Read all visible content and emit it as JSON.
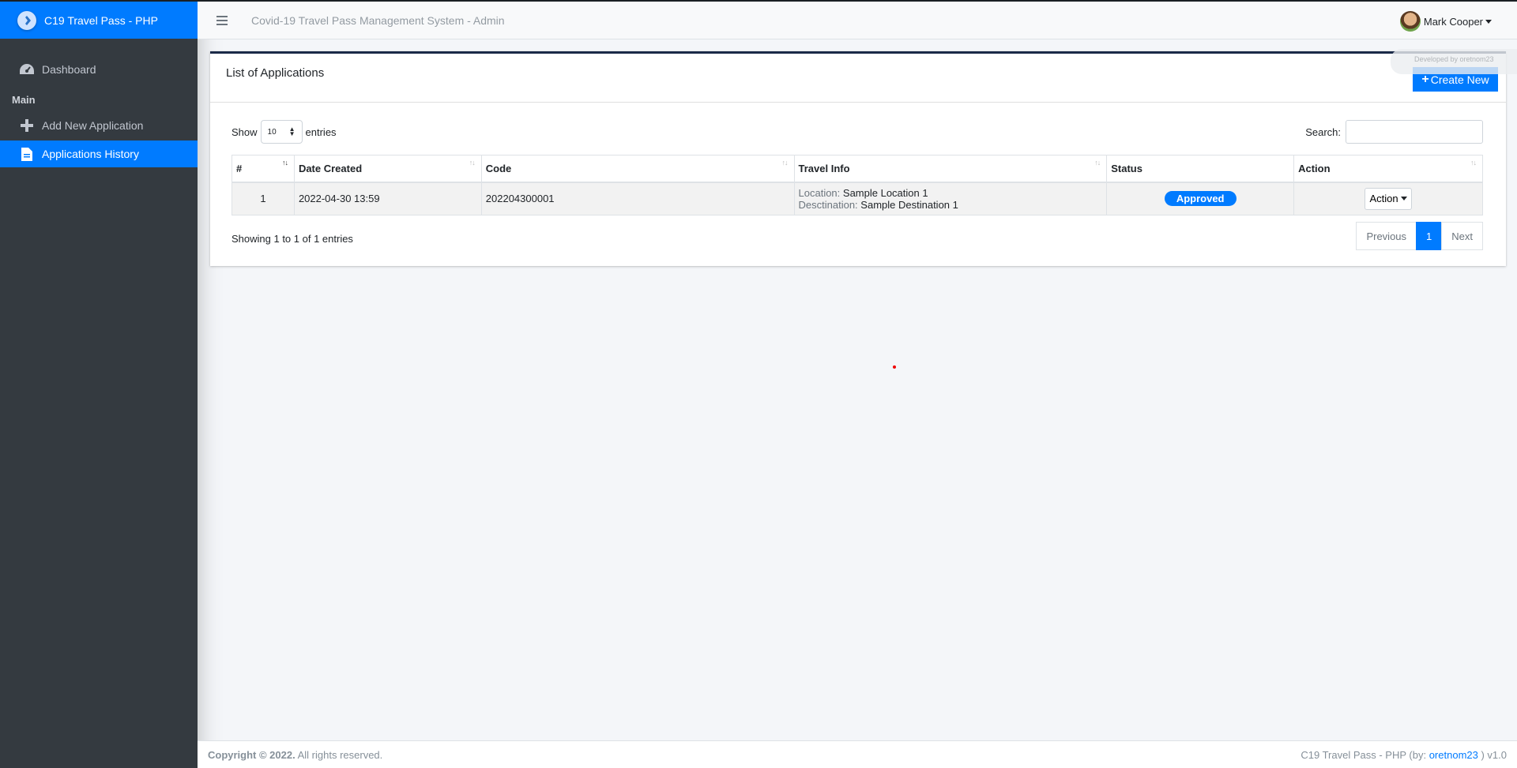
{
  "brand": {
    "name": "C19 Travel Pass - PHP"
  },
  "sidebar": {
    "items": [
      {
        "label": "Dashboard",
        "icon": "dashboard-icon"
      },
      {
        "label": "Add New Application",
        "icon": "plus-icon"
      },
      {
        "label": "Applications History",
        "icon": "document-icon",
        "active": true
      }
    ],
    "section_header": "Main"
  },
  "topbar": {
    "system_title": "Covid-19 Travel Pass Management System - Admin",
    "user_name": "Mark Cooper",
    "dev_note": "Developed by oretnom23"
  },
  "card": {
    "title": "List of Applications",
    "create_label": "Create New"
  },
  "table_controls": {
    "show_label": "Show",
    "entries_value": "10",
    "entries_label": "entries",
    "search_label": "Search:"
  },
  "table": {
    "headers": [
      "#",
      "Date Created",
      "Code",
      "Travel Info",
      "Status",
      "Action"
    ],
    "rows": [
      {
        "num": "1",
        "date_created": "2022-04-30 13:59",
        "code": "202204300001",
        "location_label": "Location:",
        "location": "Sample Location 1",
        "destination_label": "Desctination:",
        "destination": "Sample Destination 1",
        "status": "Approved",
        "action_label": "Action"
      }
    ]
  },
  "pagination": {
    "info": "Showing 1 to 1 of 1 entries",
    "previous": "Previous",
    "current": "1",
    "next": "Next"
  },
  "footer": {
    "copyright_bold": "Copyright © 2022.",
    "copyright_rest": "All rights reserved.",
    "right_prefix": "C19 Travel Pass - PHP (by:",
    "author": "oretnom23",
    "right_suffix": ") v1.0"
  },
  "colors": {
    "primary": "#007bff",
    "sidebar": "#343a40"
  }
}
